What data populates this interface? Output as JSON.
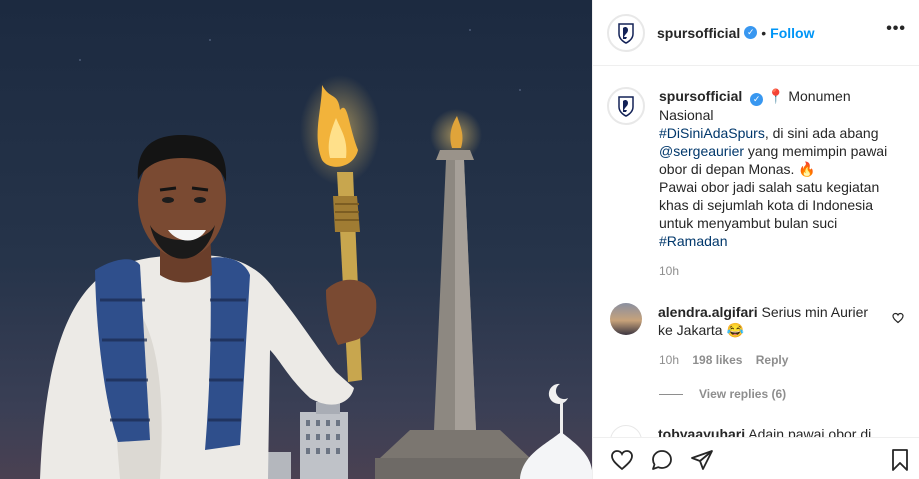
{
  "post": {
    "username": "spursofficial",
    "verified_mark": "✓",
    "dot": "•",
    "follow_label": "Follow",
    "more_label": "•••"
  },
  "caption": {
    "username": "spursofficial",
    "location_pin": "📍",
    "text_1": "Monumen Nasional",
    "hashtag_1": "#DiSiniAdaSpurs",
    "text_2": ", di sini ada abang ",
    "mention": "@sergeaurier",
    "text_3": " yang memimpin pawai obor di depan Monas. 🔥",
    "text_4": "Pawai obor jadi salah satu kegiatan khas di sejumlah kota di Indonesia untuk menyambut bulan suci ",
    "hashtag_2": "#Ramadan",
    "time": "10h"
  },
  "comment_1": {
    "username": "alendra.algifari",
    "text": "Serius min Aurier ke Jakarta 😂",
    "time": "10h",
    "likes": "198 likes",
    "reply_label": "Reply",
    "view_replies": "View replies (6)"
  },
  "comment_2": {
    "username": "tobyaayuhari",
    "text": "Adain pawai obor di"
  },
  "icons": {
    "like": "heart-icon",
    "comment": "comment-icon",
    "share": "paper-plane-icon",
    "save": "bookmark-icon",
    "more": "more-dots-icon",
    "verified": "verified-badge-icon"
  },
  "colors": {
    "accent": "#0095f6",
    "link": "#00376b",
    "muted": "#8e8e8e",
    "verified": "#3897f0"
  }
}
